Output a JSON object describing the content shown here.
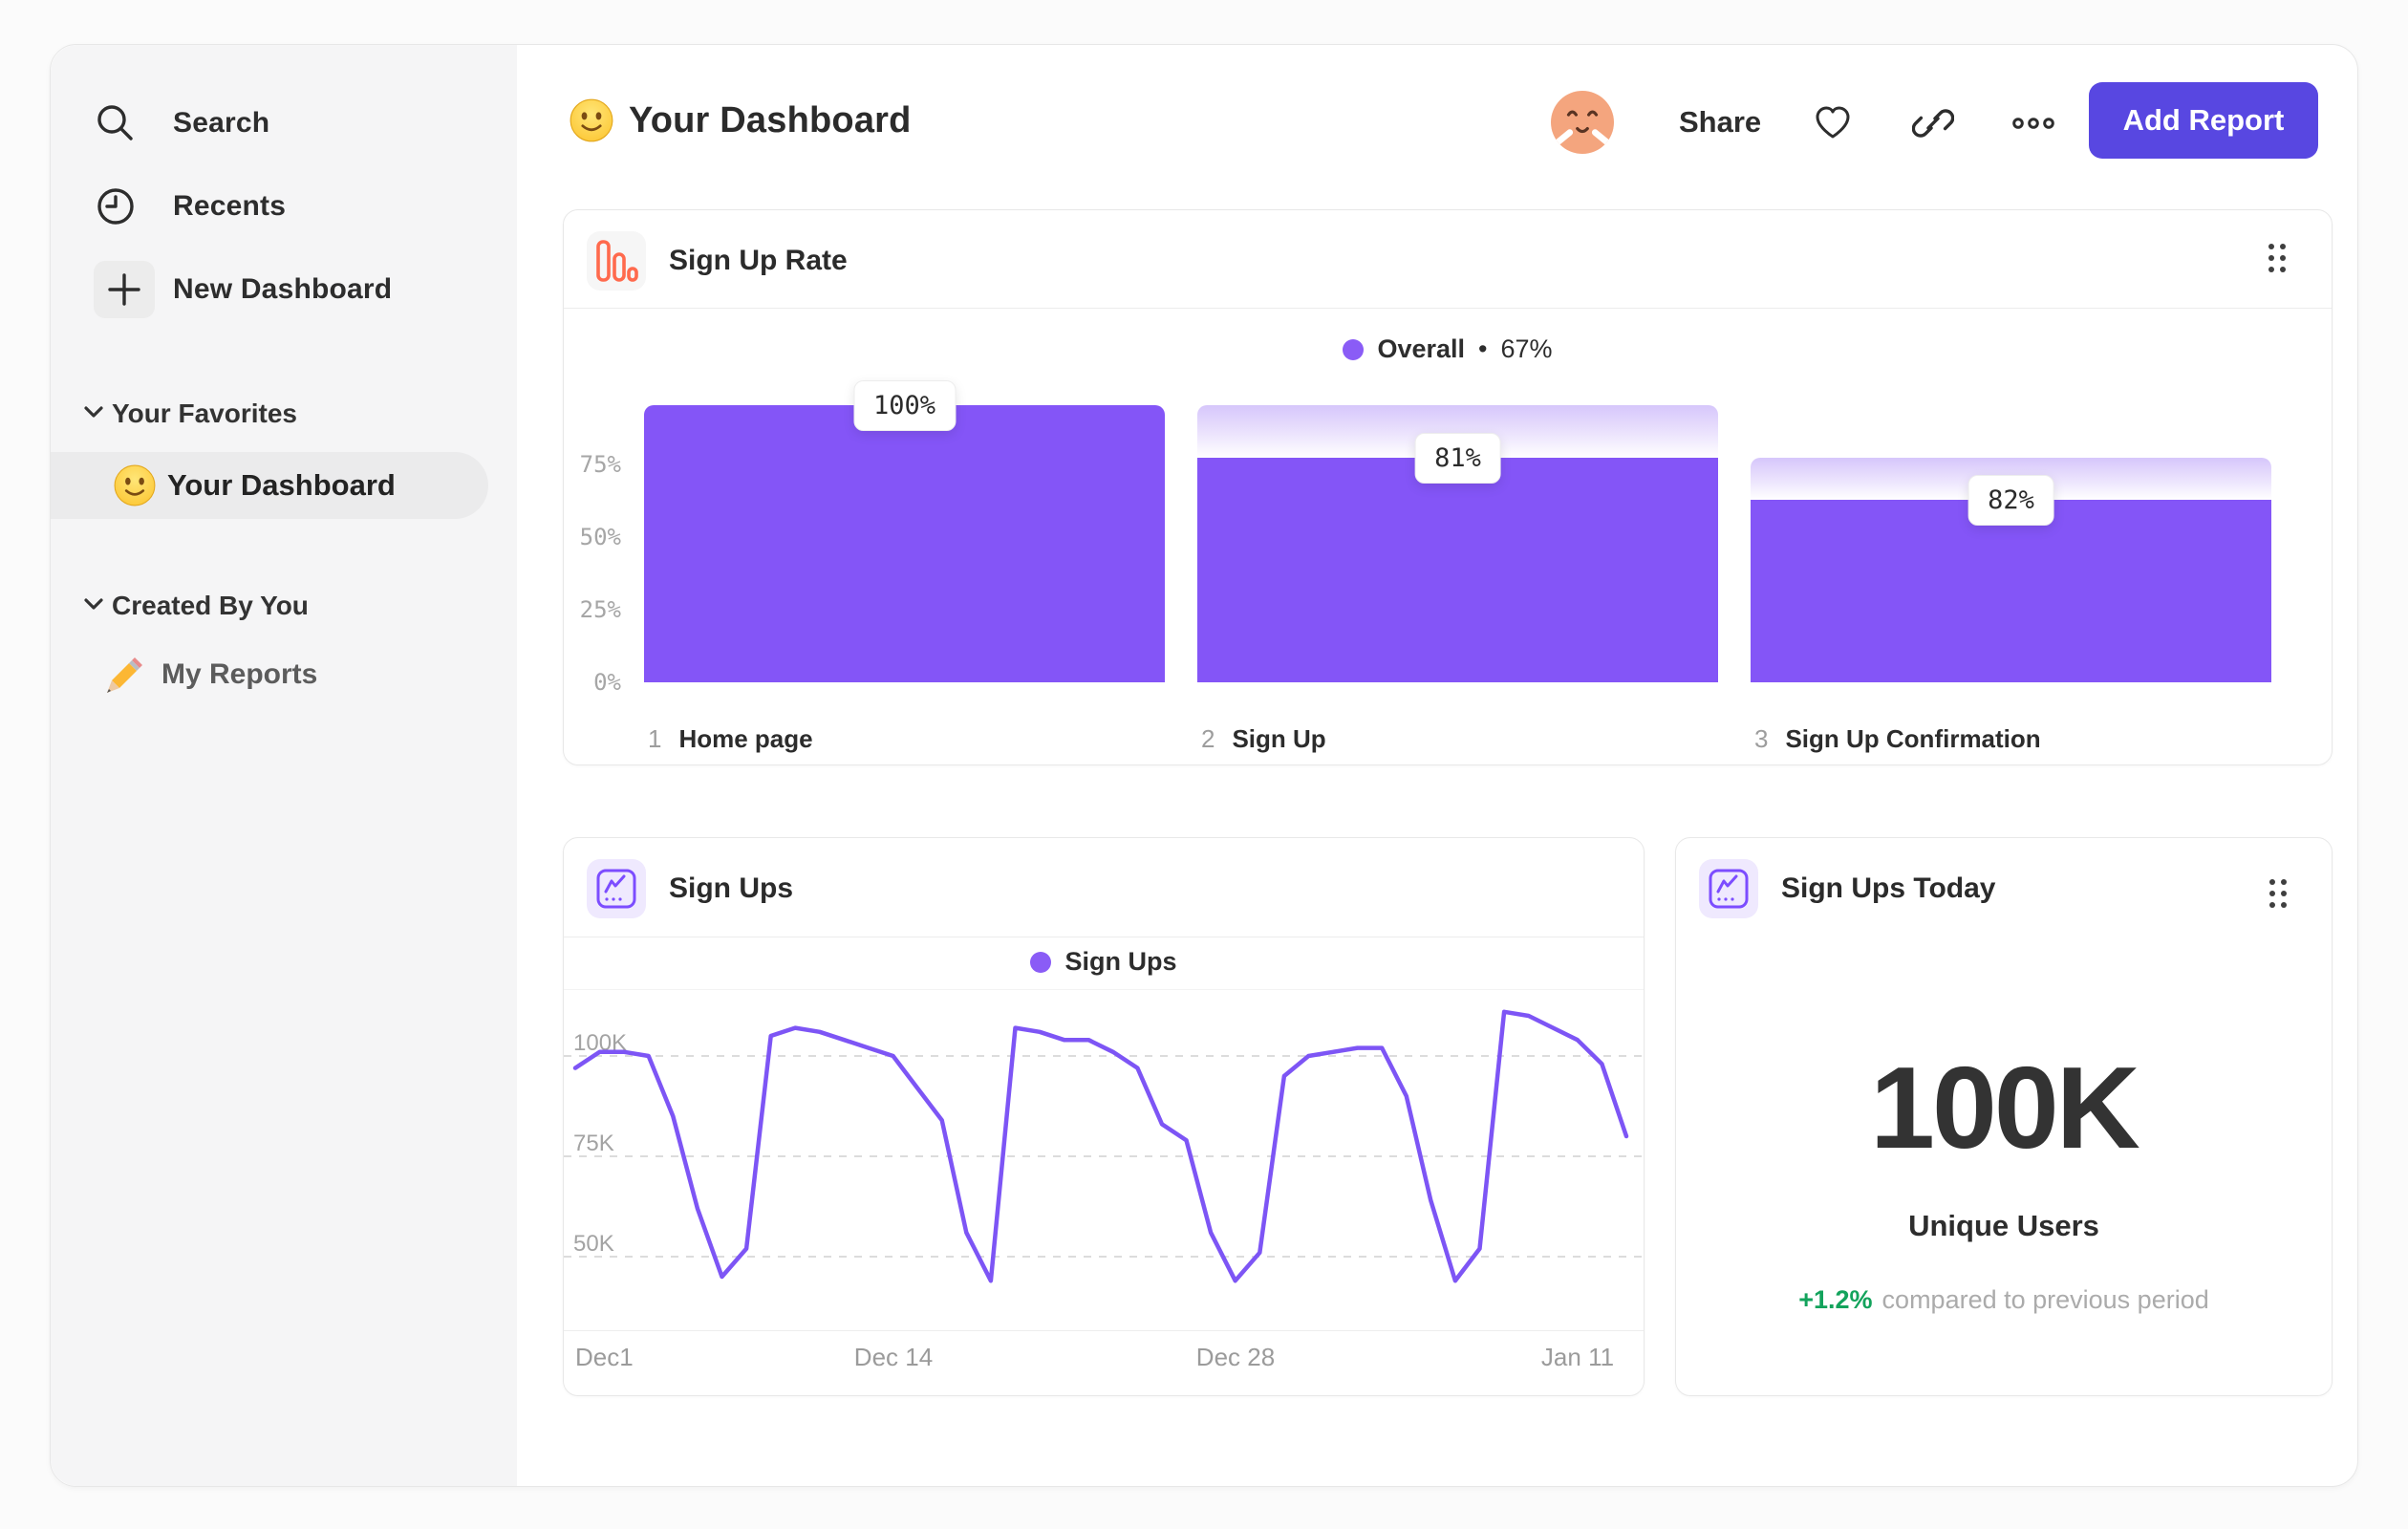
{
  "colors": {
    "accent": "#5847e1",
    "chart_purple": "#8455f7",
    "orange_icon": "#ff6a4d",
    "green": "#13a35c",
    "sidebar_bg": "#f5f5f6"
  },
  "sidebar": {
    "items": [
      {
        "icon": "search-icon",
        "label": "Search"
      },
      {
        "icon": "clock-icon",
        "label": "Recents"
      },
      {
        "icon": "plus-icon",
        "label": "New Dashboard"
      }
    ],
    "sections": [
      {
        "label": "Your Favorites",
        "items": [
          {
            "emoji": "smiley",
            "label": "Your Dashboard",
            "selected": true
          }
        ]
      },
      {
        "label": "Created By You",
        "items": [
          {
            "emoji": "pencil",
            "label": "My Reports",
            "selected": false
          }
        ]
      }
    ]
  },
  "header": {
    "emoji": "smiley",
    "title": "Your Dashboard",
    "share_label": "Share",
    "add_report_label": "Add Report"
  },
  "chart_data": [
    {
      "type": "funnel-bar",
      "title": "Sign Up Rate",
      "legend_label": "Overall",
      "legend_sep": "•",
      "overall_label": "67%",
      "overall_pct": 67,
      "yticks": [
        "75%",
        "50%",
        "25%",
        "0%"
      ],
      "ylim": [
        0,
        100
      ],
      "categories": [
        "Home page",
        "Sign Up",
        "Sign Up Confirmation"
      ],
      "steps": [
        {
          "n": "1",
          "name": "Home page",
          "label": "100%"
        },
        {
          "n": "2",
          "name": "Sign Up",
          "label": "81%"
        },
        {
          "n": "3",
          "name": "Sign Up Confirmation",
          "label": "82%"
        }
      ],
      "step_conversion_pct": [
        100,
        81,
        82
      ],
      "cumulative_pct": [
        100,
        81,
        66
      ]
    },
    {
      "type": "line",
      "title": "Sign Ups",
      "legend": "Sign Ups",
      "yticks": [
        "100K",
        "75K",
        "50K"
      ],
      "ytick_values_k": [
        100,
        75,
        50
      ],
      "xticks": [
        "Dec1",
        "Dec 14",
        "Dec 28",
        "Jan 11"
      ],
      "xtick_day_index": [
        0,
        13,
        27,
        41
      ],
      "x_range_days": 44,
      "ylim_k": [
        40,
        114
      ],
      "grid": "dotted-horizontal",
      "legend_position": "top-center",
      "series": [
        {
          "name": "Sign Ups",
          "values_k": [
            97,
            101,
            101,
            100,
            85,
            62,
            45,
            52,
            105,
            107,
            106,
            104,
            102,
            100,
            92,
            84,
            56,
            44,
            107,
            106,
            104,
            104,
            101,
            97,
            83,
            79,
            56,
            44,
            51,
            95,
            100,
            101,
            102,
            102,
            90,
            64,
            44,
            52,
            111,
            110,
            107,
            104,
            98,
            80
          ]
        }
      ]
    },
    {
      "type": "metric",
      "title": "Sign Ups Today",
      "value": "100K",
      "label": "Unique Users",
      "delta": "+1.2%",
      "delta_text": "compared to previous period"
    }
  ]
}
